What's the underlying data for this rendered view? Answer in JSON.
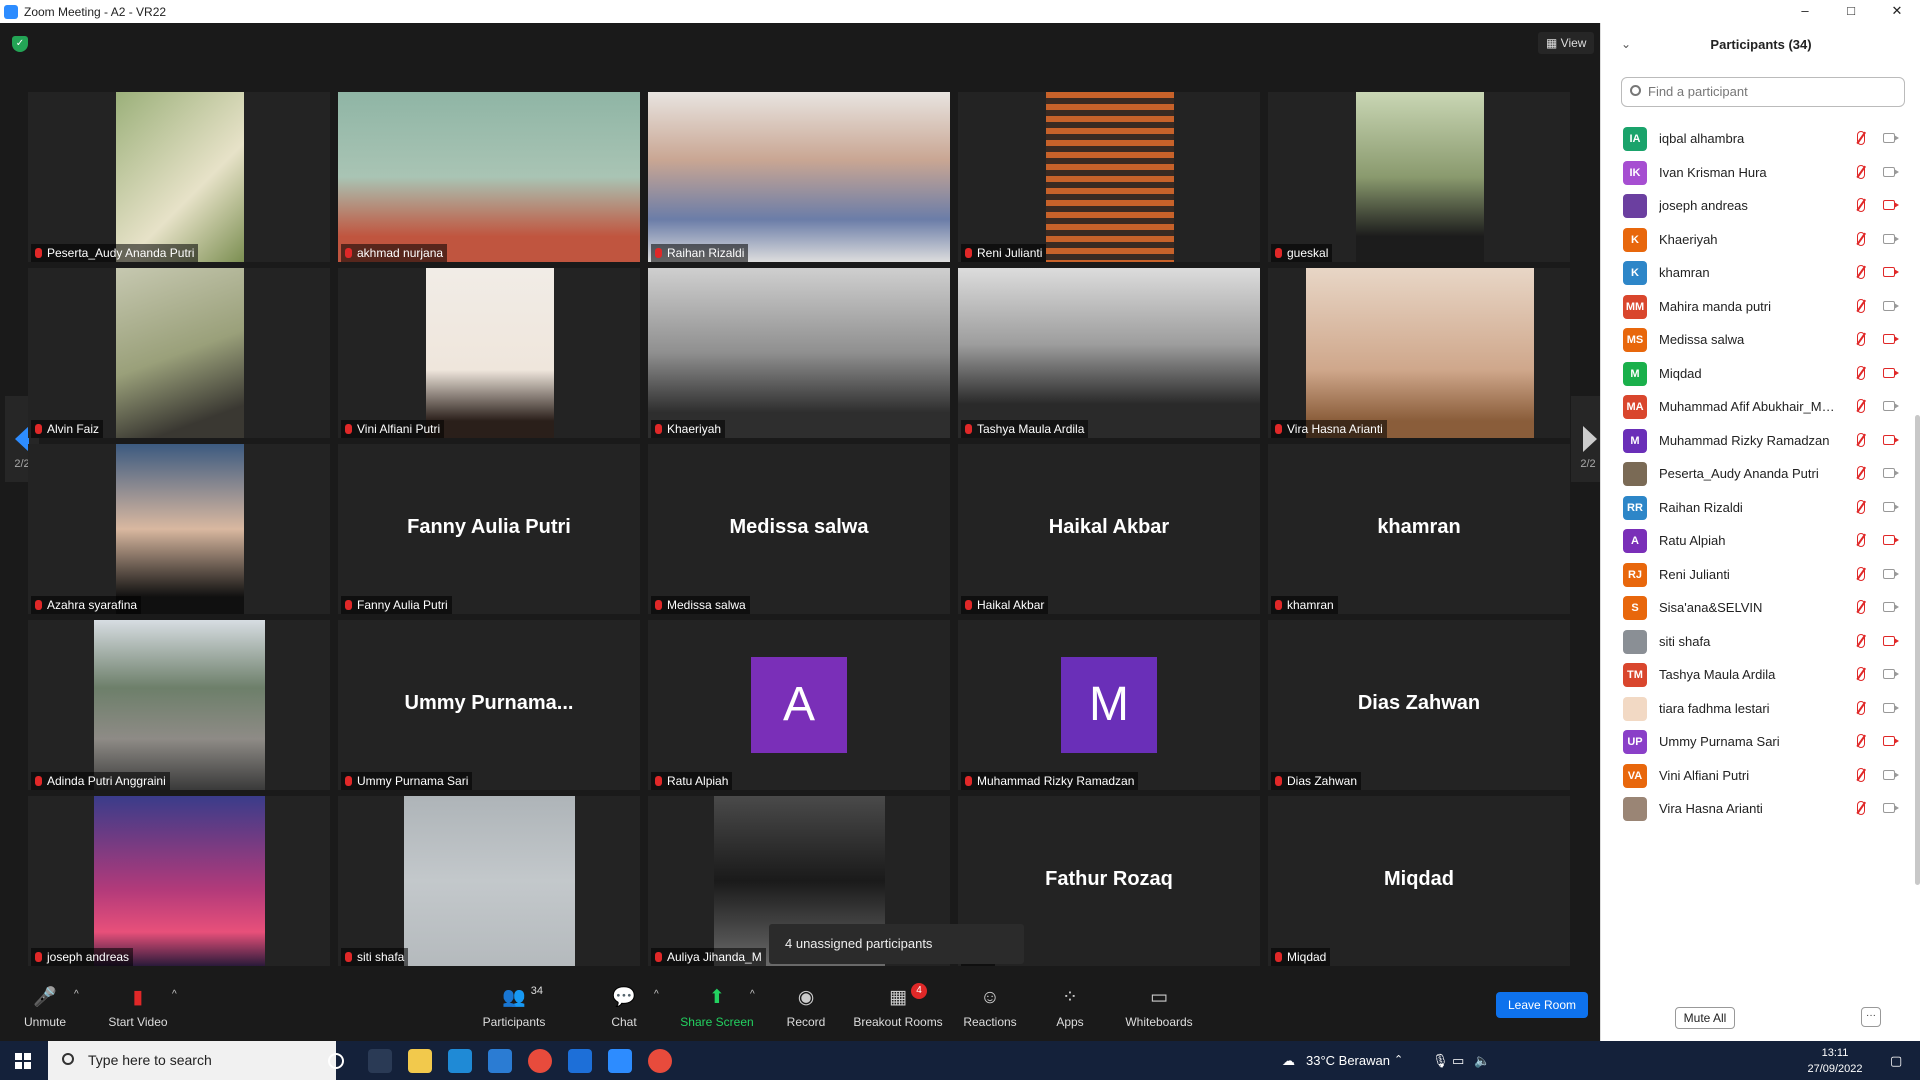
{
  "window": {
    "title": "Zoom Meeting - A2 - VR22",
    "minimize": "–",
    "maximize": "□",
    "close": "✕"
  },
  "meeting": {
    "view_label": "View",
    "tooltip": "4 unassigned participants",
    "page_indicator_left": "2/2",
    "page_indicator_right": "2/2",
    "tiles": [
      {
        "name": "Peserta_Audy Ananda Putri",
        "center": "",
        "avatar": ""
      },
      {
        "name": "akhmad nurjana",
        "center": "",
        "avatar": ""
      },
      {
        "name": "Raihan Rizaldi",
        "center": "",
        "avatar": ""
      },
      {
        "name": "Reni Julianti",
        "center": "",
        "avatar": ""
      },
      {
        "name": "gueskal",
        "center": "",
        "avatar": ""
      },
      {
        "name": "Alvin Faiz",
        "center": "",
        "avatar": ""
      },
      {
        "name": "Vini Alfiani Putri",
        "center": "",
        "avatar": ""
      },
      {
        "name": "Khaeriyah",
        "center": "",
        "avatar": ""
      },
      {
        "name": "Tashya Maula Ardila",
        "center": "",
        "avatar": ""
      },
      {
        "name": "Vira Hasna Arianti",
        "center": "",
        "avatar": ""
      },
      {
        "name": "Azahra syarafina",
        "center": "",
        "avatar": ""
      },
      {
        "name": "Fanny Aulia Putri",
        "center": "Fanny Aulia Putri",
        "avatar": ""
      },
      {
        "name": "Medissa salwa",
        "center": "Medissa salwa",
        "avatar": ""
      },
      {
        "name": "Haikal Akbar",
        "center": "Haikal Akbar",
        "avatar": ""
      },
      {
        "name": "khamran",
        "center": "khamran",
        "avatar": ""
      },
      {
        "name": "Adinda Putri Anggraini",
        "center": "",
        "avatar": ""
      },
      {
        "name": "Ummy Purnama Sari",
        "center": "Ummy  Purnama...",
        "avatar": ""
      },
      {
        "name": "Ratu Alpiah",
        "center": "",
        "avatar": "A"
      },
      {
        "name": "Muhammad Rizky Ramadzan",
        "center": "",
        "avatar": "M"
      },
      {
        "name": "Dias Zahwan",
        "center": "Dias Zahwan",
        "avatar": ""
      },
      {
        "name": "joseph andreas",
        "center": "",
        "avatar": ""
      },
      {
        "name": "siti shafa",
        "center": "",
        "avatar": ""
      },
      {
        "name": "Auliya Jihanda_M",
        "center": "",
        "avatar": ""
      },
      {
        "name": "ozaq",
        "center": "Fathur Rozaq",
        "avatar": ""
      },
      {
        "name": "Miqdad",
        "center": "Miqdad",
        "avatar": ""
      }
    ]
  },
  "toolbar": {
    "unmute": "Unmute",
    "start_video": "Start Video",
    "participants": "Participants",
    "participants_count": "34",
    "chat": "Chat",
    "share_screen": "Share Screen",
    "record": "Record",
    "breakout_rooms": "Breakout Rooms",
    "breakout_badge": "4",
    "reactions": "Reactions",
    "apps": "Apps",
    "whiteboards": "Whiteboards",
    "leave": "Leave Room"
  },
  "participants_panel": {
    "title": "Participants (34)",
    "search_placeholder": "Find a participant",
    "mute_all": "Mute All",
    "more": "···",
    "items": [
      {
        "initials": "IA",
        "name": "iqbal alhambra",
        "color": "#1aa36b",
        "cam_off": false
      },
      {
        "initials": "IK",
        "name": "Ivan Krisman Hura",
        "color": "#a64ed1",
        "cam_off": false
      },
      {
        "initials": "",
        "name": "joseph andreas",
        "color": "#6b3fa0",
        "cam_off": true
      },
      {
        "initials": "K",
        "name": "Khaeriyah",
        "color": "#e8670c",
        "cam_off": false
      },
      {
        "initials": "K",
        "name": "khamran",
        "color": "#2d86c8",
        "cam_off": true
      },
      {
        "initials": "MM",
        "name": "Mahira manda putri",
        "color": "#d9462d",
        "cam_off": false
      },
      {
        "initials": "MS",
        "name": "Medissa salwa",
        "color": "#e8670c",
        "cam_off": true
      },
      {
        "initials": "M",
        "name": "Miqdad",
        "color": "#1ab04b",
        "cam_off": true
      },
      {
        "initials": "MA",
        "name": "Muhammad Afif Abukhair_MNJ...",
        "color": "#d9462d",
        "cam_off": false
      },
      {
        "initials": "M",
        "name": "Muhammad Rizky Ramadzan",
        "color": "#6a2fb8",
        "cam_off": true
      },
      {
        "initials": "",
        "name": "Peserta_Audy Ananda Putri",
        "color": "#7a6a55",
        "cam_off": false
      },
      {
        "initials": "RR",
        "name": "Raihan Rizaldi",
        "color": "#2d86c8",
        "cam_off": false
      },
      {
        "initials": "A",
        "name": "Ratu Alpiah",
        "color": "#7a2fb8",
        "cam_off": true
      },
      {
        "initials": "RJ",
        "name": "Reni Julianti",
        "color": "#e8670c",
        "cam_off": false
      },
      {
        "initials": "S",
        "name": "Sisa'ana&SELVIN",
        "color": "#e8670c",
        "cam_off": false
      },
      {
        "initials": "",
        "name": "siti shafa",
        "color": "#8a8f95",
        "cam_off": true
      },
      {
        "initials": "TM",
        "name": "Tashya Maula Ardila",
        "color": "#d9462d",
        "cam_off": false
      },
      {
        "initials": "",
        "name": "tiara fadhma lestari",
        "color": "#f2d9c4",
        "cam_off": false
      },
      {
        "initials": "UP",
        "name": "Ummy Purnama Sari",
        "color": "#8a3fc8",
        "cam_off": true
      },
      {
        "initials": "VA",
        "name": "Vini Alfiani Putri",
        "color": "#e8670c",
        "cam_off": false
      },
      {
        "initials": "",
        "name": "Vira Hasna Arianti",
        "color": "#9a8575",
        "cam_off": false
      }
    ]
  },
  "taskbar": {
    "search_placeholder": "Type here to search",
    "weather": "33°C  Berawan",
    "time": "13:11",
    "date": "27/09/2022"
  }
}
